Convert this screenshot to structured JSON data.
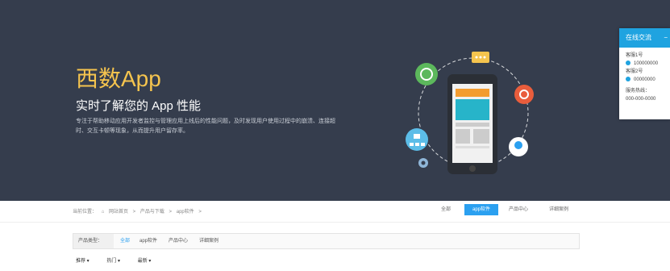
{
  "hero": {
    "title": "西数App",
    "subtitle": "实时了解您的 App 性能",
    "description": "专注于帮助移动应用开发者监控与管理应用上线后的性能问题，及时发现用户使用过程中的崩溃、连接超时、交互卡顿等现象，从而提升用户留存率。"
  },
  "float_panel": {
    "title": "在线交流",
    "collapse": "−",
    "qq_label_1": "客服1号",
    "qq_value_1": "100000000",
    "qq_label_2": "客服2号",
    "qq_value_2": "00000000",
    "hotline_label": "服务热线：",
    "hotline_value": "000-000-0000"
  },
  "breadcrumb": {
    "prefix": "当前位置：",
    "home": "网站首页",
    "sep": ">",
    "level2": "产品与下载",
    "level3": "app软件"
  },
  "tabs": [
    "全部",
    "app软件",
    "产品中心",
    "详细案例"
  ],
  "filter": {
    "label": "产品类型：",
    "options": [
      "全部",
      "app软件",
      "产品中心",
      "详细案例"
    ]
  },
  "sort": [
    "推荐 ▾",
    "热门 ▾",
    "最新 ▾"
  ],
  "colors": {
    "hero_bg": "#353d4d",
    "title": "#f5c44e",
    "accent": "#2ba0f0"
  }
}
